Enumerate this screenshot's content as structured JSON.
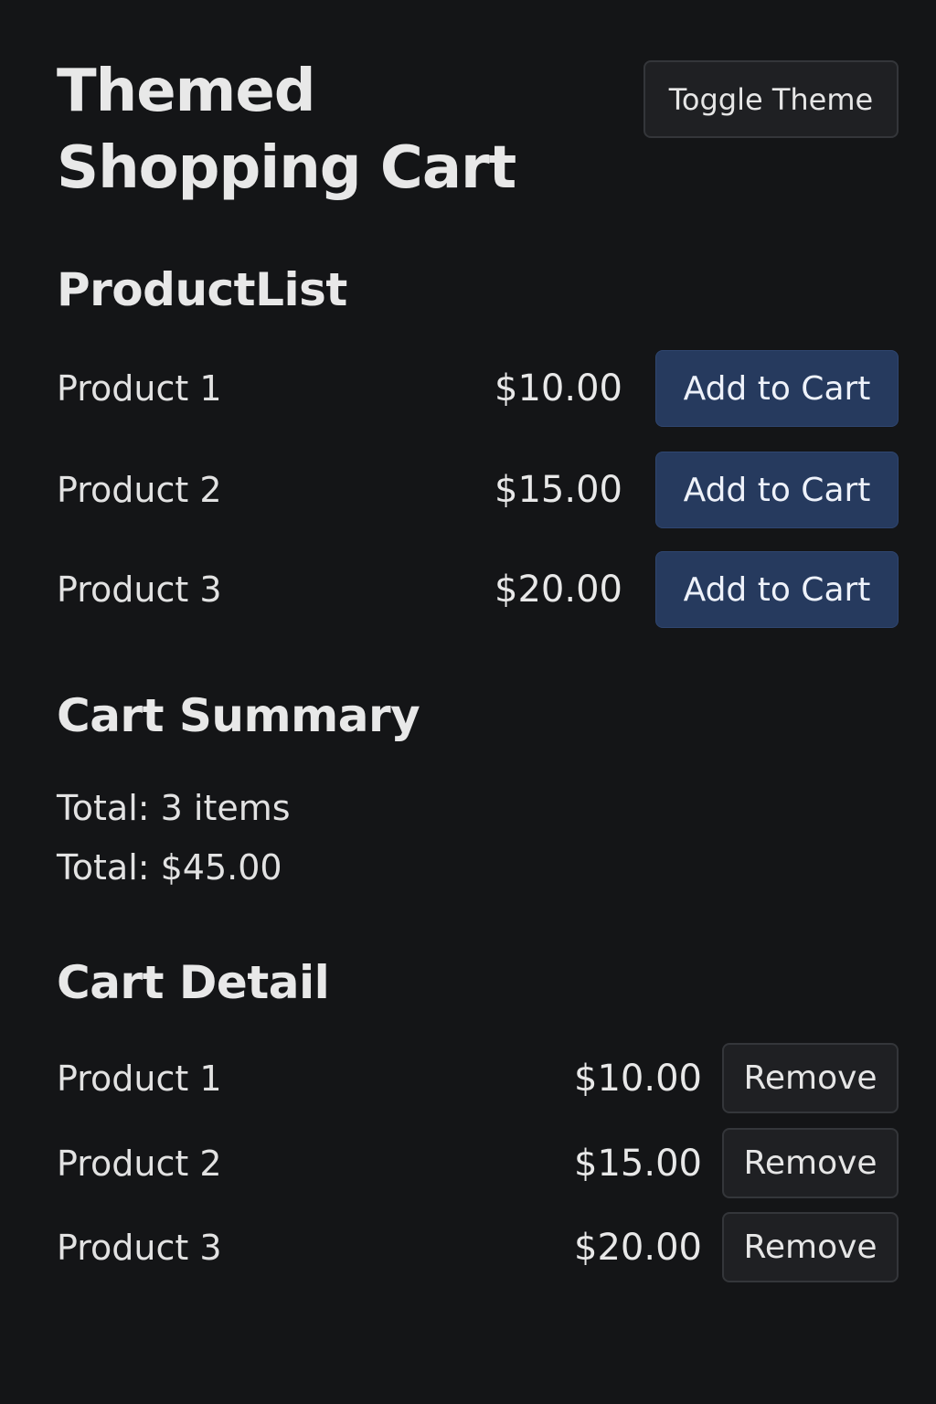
{
  "header": {
    "title": "Themed Shopping Cart",
    "toggle_theme_label": "Toggle Theme"
  },
  "product_list": {
    "heading": "ProductList",
    "add_label": "Add to Cart",
    "items": [
      {
        "name": "Product 1",
        "price": "$10.00"
      },
      {
        "name": "Product 2",
        "price": "$15.00"
      },
      {
        "name": "Product 3",
        "price": "$20.00"
      }
    ]
  },
  "cart_summary": {
    "heading": "Cart Summary",
    "items_line": "Total: 3 items",
    "total_line": "Total: $45.00"
  },
  "cart_detail": {
    "heading": "Cart Detail",
    "remove_label": "Remove",
    "items": [
      {
        "name": "Product 1",
        "price": "$10.00"
      },
      {
        "name": "Product 2",
        "price": "$15.00"
      },
      {
        "name": "Product 3",
        "price": "$20.00"
      }
    ]
  },
  "colors": {
    "background": "#141517",
    "primary_button": "#263a5e",
    "secondary_button": "#1f2023",
    "text": "#e6e6e6"
  }
}
